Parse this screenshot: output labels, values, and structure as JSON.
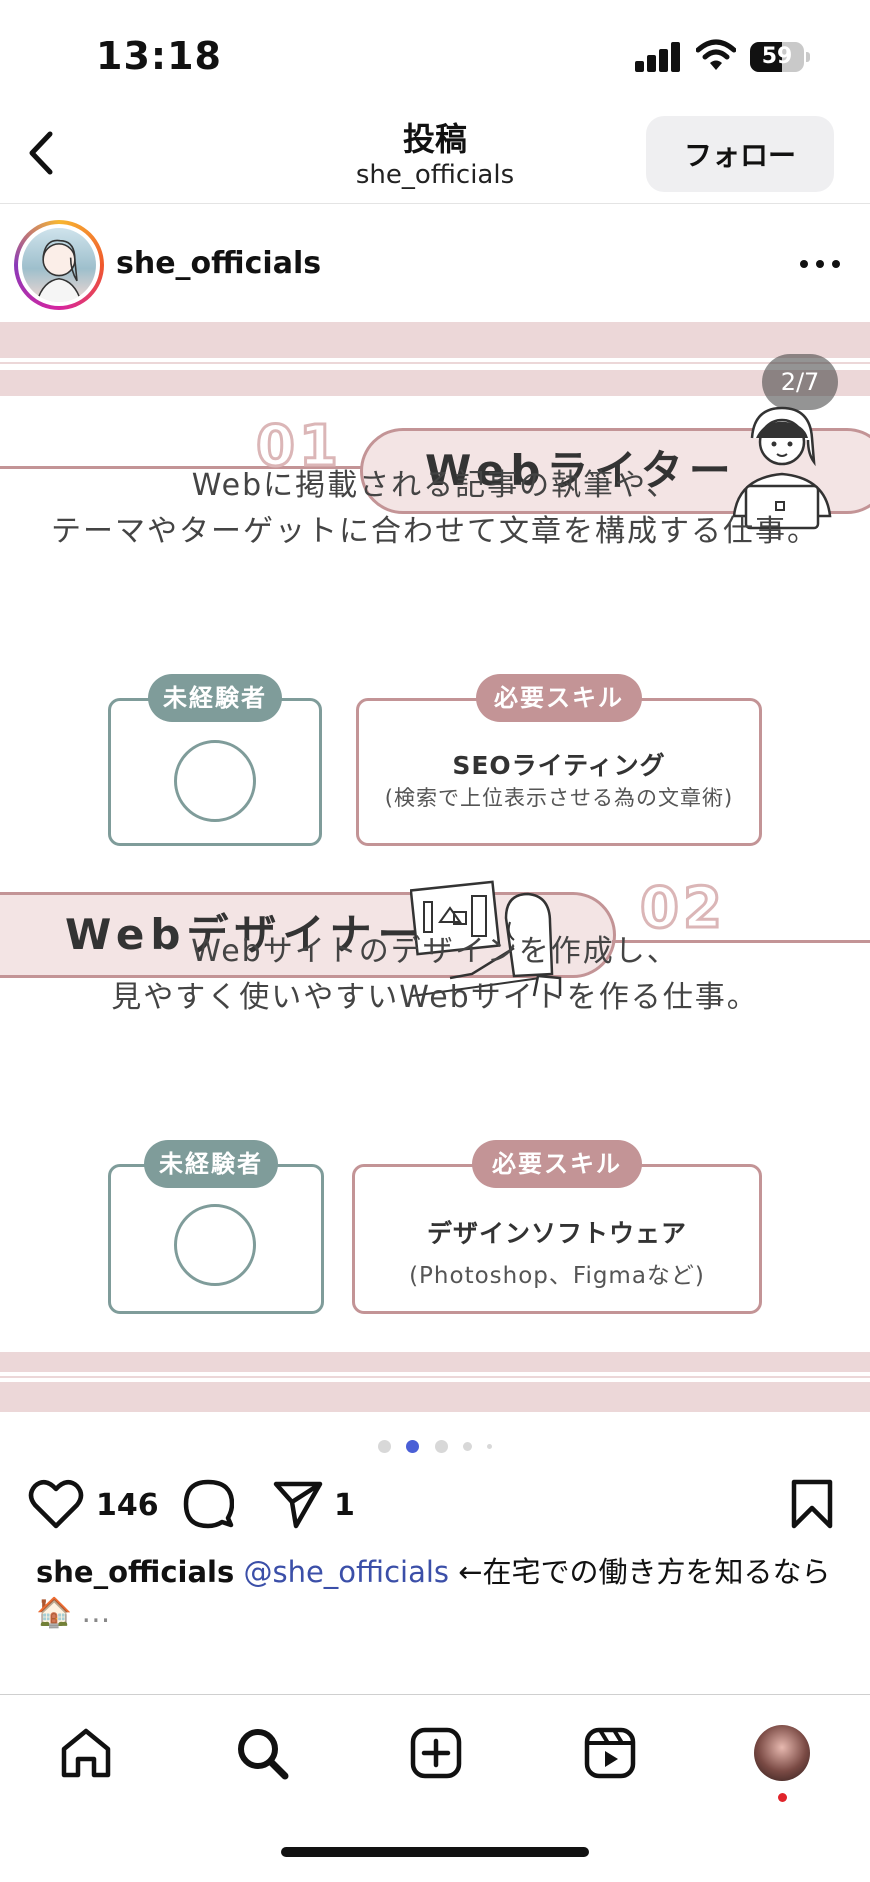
{
  "status_bar": {
    "time": "13:18",
    "battery": "59",
    "battery_level": 0.59
  },
  "header": {
    "title": "投稿",
    "subtitle": "she_officials",
    "follow_label": "フォロー"
  },
  "post": {
    "username": "she_officials",
    "slide_counter": "2/7",
    "sections": [
      {
        "number": "01",
        "title": "Webライター",
        "desc_line1": "Webに掲載される記事の執筆や、",
        "desc_line2": "テーマやターゲットに合わせて文章を構成する仕事。",
        "beginner_tag": "未経験者",
        "skill_tag": "必要スキル",
        "skill_main": "SEOライティング",
        "skill_sub": "(検索で上位表示させる為の文章術)"
      },
      {
        "number": "02",
        "title": "Webデザイナー",
        "desc_line1": "Webサイトのデザインを作成し、",
        "desc_line2": "見やすく使いやすいWebサイトを作る仕事。",
        "beginner_tag": "未経験者",
        "skill_tag": "必要スキル",
        "skill_main": "デザインソフトウェア",
        "skill_sub": "(Photoshop、Figmaなど)"
      }
    ],
    "carousel_active_index": 1,
    "likes": "146",
    "shares": "1",
    "caption": {
      "user": "she_officials",
      "mention": "@she_officials",
      "text": "←在宅での働き方を知るなら",
      "emoji": "🏠",
      "more": "…"
    }
  },
  "colors": {
    "accent_pink": "#c39496",
    "band_pink": "#ecd7d8",
    "accent_green": "#7f9c9a",
    "active_dot": "#4a5fd6",
    "mention_blue": "#3b4fa8"
  },
  "icons": {
    "back": "chevron-left-icon",
    "more": "more-dots-icon",
    "like": "heart-icon",
    "comment": "comment-bubble-icon",
    "share": "paper-plane-icon",
    "save": "bookmark-icon",
    "nav": [
      "home-icon",
      "search-icon",
      "create-icon",
      "reels-icon",
      "profile-avatar"
    ]
  }
}
